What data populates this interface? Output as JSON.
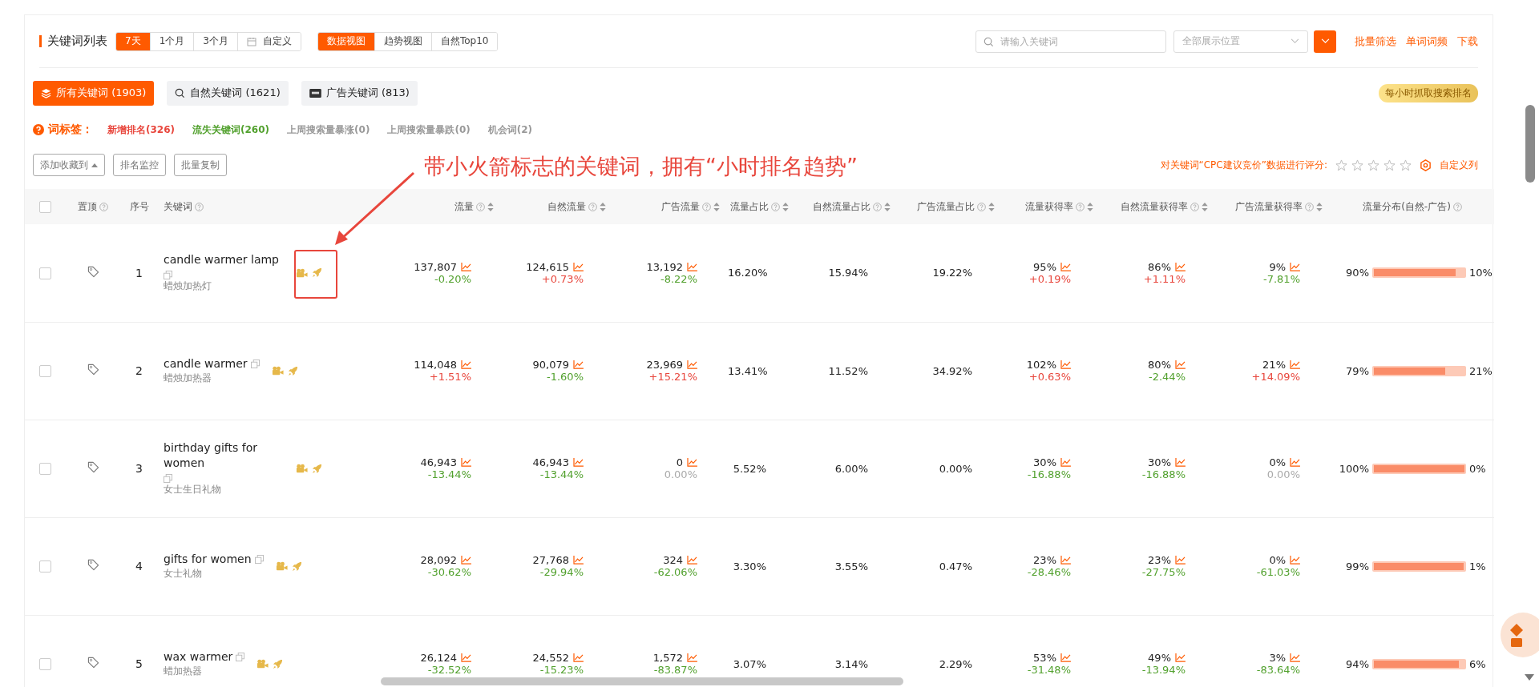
{
  "header": {
    "title": "关键词列表",
    "periods": [
      {
        "label": "7天",
        "selected": true,
        "kind": "plain"
      },
      {
        "label": "1个月",
        "selected": false,
        "kind": "plain"
      },
      {
        "label": "3个月",
        "selected": false,
        "kind": "plain"
      },
      {
        "label": "自定义",
        "selected": false,
        "kind": "calendar"
      }
    ],
    "views": [
      {
        "label": "数据视图",
        "selected": true
      },
      {
        "label": "趋势视图",
        "selected": false
      },
      {
        "label": "自然Top10",
        "selected": false
      }
    ],
    "search": {
      "placeholder": "请输入关键词"
    },
    "position_select": {
      "placeholder": "全部展示位置"
    },
    "links": [
      "批量筛选",
      "单词词频",
      "下载"
    ]
  },
  "filters": {
    "chips": [
      {
        "label": "所有关键词 (1903)",
        "kind": "all",
        "selected": true
      },
      {
        "label": "自然关键词 (1621)",
        "kind": "organic",
        "selected": false
      },
      {
        "label": "广告关键词 (813)",
        "kind": "ad",
        "selected": false
      }
    ],
    "badge": "每小时抓取搜索排名"
  },
  "tags": {
    "label": "词标签：",
    "items": [
      {
        "label": "新增排名(326)",
        "color": "#e8463c"
      },
      {
        "label": "流失关键词(260)",
        "color": "#52a12e"
      },
      {
        "label": "上周搜索量暴涨(0)",
        "color": "#999999"
      },
      {
        "label": "上周搜索量暴跌(0)",
        "color": "#999999"
      },
      {
        "label": "机会词(2)",
        "color": "#999999"
      }
    ]
  },
  "actions": {
    "buttons": [
      {
        "label": "添加收藏到",
        "kind": "dropdown"
      },
      {
        "label": "排名监控",
        "kind": "plain"
      },
      {
        "label": "批量复制",
        "kind": "plain"
      }
    ],
    "rating": {
      "label": "对关键词“CPC建议竞价”数据进行评分:",
      "stars": 0
    },
    "customize": "自定义列"
  },
  "annotation": {
    "text": "带小火箭标志的关键词，拥有“小时排名趋势”"
  },
  "table": {
    "select_all": {
      "checked": false
    },
    "columns": [
      {
        "label": "置顶",
        "help": true,
        "sortable": false
      },
      {
        "label": "序号",
        "help": false,
        "sortable": false
      },
      {
        "label": "关键词",
        "help": true,
        "sortable": false
      },
      {
        "label": "流量",
        "help": true,
        "sortable": true
      },
      {
        "label": "自然流量",
        "help": true,
        "sortable": true
      },
      {
        "label": "广告流量",
        "help": true,
        "sortable": true
      },
      {
        "label": "流量占比",
        "help": true,
        "sortable": true
      },
      {
        "label": "自然流量占比",
        "help": true,
        "sortable": true
      },
      {
        "label": "广告流量占比",
        "help": true,
        "sortable": true
      },
      {
        "label": "流量获得率",
        "help": true,
        "sortable": true
      },
      {
        "label": "自然流量获得率",
        "help": true,
        "sortable": true
      },
      {
        "label": "广告流量获得率",
        "help": true,
        "sortable": true
      },
      {
        "label": "流量分布(自然-广告)",
        "help": true,
        "sortable": false
      }
    ],
    "rows": [
      {
        "checked": false,
        "index": "1",
        "keyword": "candle warmer lamp",
        "translation": "蜡烛加热灯",
        "traffic": {
          "value": "137,807",
          "change": "-0.20%",
          "color": "#52a12e"
        },
        "organic": {
          "value": "124,615",
          "change": "+0.73%",
          "color": "#e8463c"
        },
        "ad": {
          "value": "13,192",
          "change": "-8.22%",
          "color": "#52a12e"
        },
        "traffic_share": "16.20%",
        "organic_share": "15.94%",
        "ad_share": "19.22%",
        "traffic_rate": {
          "value": "95%",
          "change": "+0.19%",
          "color": "#e8463c"
        },
        "organic_rate": {
          "value": "86%",
          "change": "+1.11%",
          "color": "#e8463c"
        },
        "ad_rate": {
          "value": "9%",
          "change": "-7.81%",
          "color": "#52a12e"
        },
        "distribution": {
          "organic": "90%",
          "ad": "10%",
          "level": 0.9
        }
      },
      {
        "checked": false,
        "index": "2",
        "keyword": "candle warmer",
        "translation": "蜡烛加热器",
        "traffic": {
          "value": "114,048",
          "change": "+1.51%",
          "color": "#e8463c"
        },
        "organic": {
          "value": "90,079",
          "change": "-1.60%",
          "color": "#52a12e"
        },
        "ad": {
          "value": "23,969",
          "change": "+15.21%",
          "color": "#e8463c"
        },
        "traffic_share": "13.41%",
        "organic_share": "11.52%",
        "ad_share": "34.92%",
        "traffic_rate": {
          "value": "102%",
          "change": "+0.63%",
          "color": "#e8463c"
        },
        "organic_rate": {
          "value": "80%",
          "change": "-2.44%",
          "color": "#52a12e"
        },
        "ad_rate": {
          "value": "21%",
          "change": "+14.09%",
          "color": "#e8463c"
        },
        "distribution": {
          "organic": "79%",
          "ad": "21%",
          "level": 0.79
        }
      },
      {
        "checked": false,
        "index": "3",
        "keyword": "birthday gifts for women",
        "translation": "女士生日礼物",
        "traffic": {
          "value": "46,943",
          "change": "-13.44%",
          "color": "#52a12e"
        },
        "organic": {
          "value": "46,943",
          "change": "-13.44%",
          "color": "#52a12e"
        },
        "ad": {
          "value": "0",
          "change": "0.00%",
          "color": "#aaaaaa"
        },
        "traffic_share": "5.52%",
        "organic_share": "6.00%",
        "ad_share": "0.00%",
        "traffic_rate": {
          "value": "30%",
          "change": "-16.88%",
          "color": "#52a12e"
        },
        "organic_rate": {
          "value": "30%",
          "change": "-16.88%",
          "color": "#52a12e"
        },
        "ad_rate": {
          "value": "0%",
          "change": "0.00%",
          "color": "#aaaaaa"
        },
        "distribution": {
          "organic": "100%",
          "ad": "0%",
          "level": 1
        }
      },
      {
        "checked": false,
        "index": "4",
        "keyword": "gifts for women",
        "translation": "女士礼物",
        "traffic": {
          "value": "28,092",
          "change": "-30.62%",
          "color": "#52a12e"
        },
        "organic": {
          "value": "27,768",
          "change": "-29.94%",
          "color": "#52a12e"
        },
        "ad": {
          "value": "324",
          "change": "-62.06%",
          "color": "#52a12e"
        },
        "traffic_share": "3.30%",
        "organic_share": "3.55%",
        "ad_share": "0.47%",
        "traffic_rate": {
          "value": "23%",
          "change": "-28.46%",
          "color": "#52a12e"
        },
        "organic_rate": {
          "value": "23%",
          "change": "-27.75%",
          "color": "#52a12e"
        },
        "ad_rate": {
          "value": "0%",
          "change": "-61.03%",
          "color": "#52a12e"
        },
        "distribution": {
          "organic": "99%",
          "ad": "1%",
          "level": 0.99
        }
      },
      {
        "checked": false,
        "index": "5",
        "keyword": "wax warmer",
        "translation": "蜡加热器",
        "traffic": {
          "value": "26,124",
          "change": "-32.52%",
          "color": "#52a12e"
        },
        "organic": {
          "value": "24,552",
          "change": "-15.23%",
          "color": "#52a12e"
        },
        "ad": {
          "value": "1,572",
          "change": "-83.87%",
          "color": "#52a12e"
        },
        "traffic_share": "3.07%",
        "organic_share": "3.14%",
        "ad_share": "2.29%",
        "traffic_rate": {
          "value": "53%",
          "change": "-31.48%",
          "color": "#52a12e"
        },
        "organic_rate": {
          "value": "49%",
          "change": "-13.94%",
          "color": "#52a12e"
        },
        "ad_rate": {
          "value": "3%",
          "change": "-83.64%",
          "color": "#52a12e"
        },
        "distribution": {
          "organic": "94%",
          "ad": "6%",
          "level": 0.94
        }
      }
    ]
  }
}
